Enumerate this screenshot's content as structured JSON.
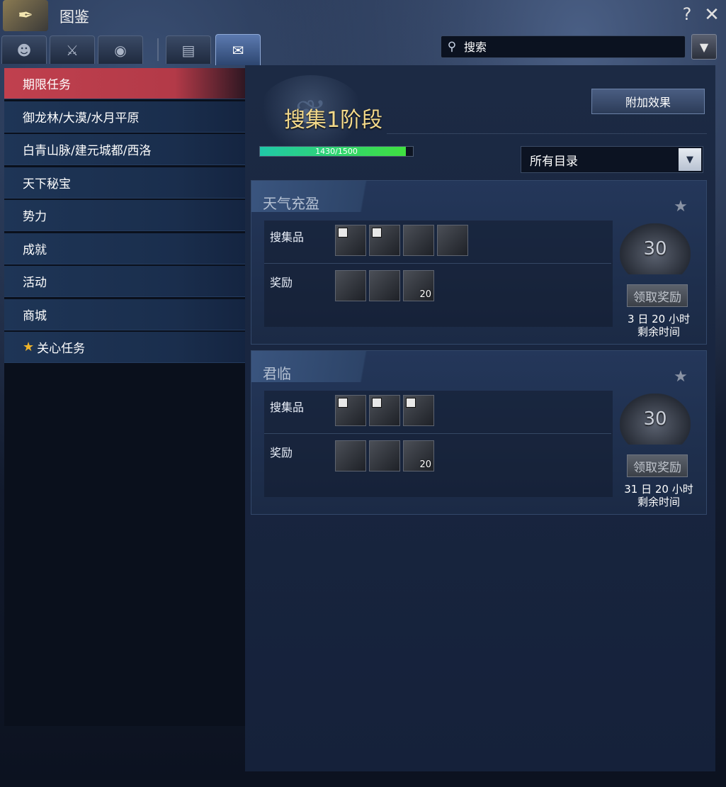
{
  "window": {
    "title": "图鉴",
    "help": "?",
    "close": "✕"
  },
  "tabs": [
    {
      "icon": "face-icon",
      "glyph": "☻"
    },
    {
      "icon": "sword-icon",
      "glyph": "⚔"
    },
    {
      "icon": "globe-icon",
      "glyph": "◉"
    },
    {
      "icon": "book-gear-icon",
      "glyph": "▤"
    },
    {
      "icon": "scroll-icon",
      "glyph": "✉"
    }
  ],
  "search": {
    "placeholder": "搜索"
  },
  "sidebar": {
    "items": [
      {
        "label": "期限任务"
      },
      {
        "label": "御龙林/大漠/水月平原"
      },
      {
        "label": "白青山脉/建元城都/西洛"
      },
      {
        "label": "天下秘宝"
      },
      {
        "label": "势力"
      },
      {
        "label": "成就"
      },
      {
        "label": "活动"
      },
      {
        "label": "商城"
      },
      {
        "label": "关心任务"
      }
    ]
  },
  "main": {
    "stage_title": "搜集1阶段",
    "progress": {
      "current": 1430,
      "max": 1500,
      "text": "1430/1500"
    },
    "extra_button": "附加效果",
    "filter": {
      "selected": "所有目录"
    }
  },
  "quests": [
    {
      "title": "天气充盈",
      "collect_label": "搜集品",
      "reward_label": "奖励",
      "reward_count": "20",
      "book_count": "30",
      "claim_label": "领取奖励",
      "time_line1": "3 日 20 小时",
      "time_line2": "剩余时间"
    },
    {
      "title": "君临",
      "collect_label": "搜集品",
      "reward_label": "奖励",
      "reward_count": "20",
      "book_count": "30",
      "claim_label": "领取奖励",
      "time_line1": "31 日 20 小时",
      "time_line2": "剩余时间"
    }
  ],
  "colors": {
    "accent_red": "#c0404e",
    "gold_title": "#f3d98a",
    "progress_green": "#40e040"
  }
}
